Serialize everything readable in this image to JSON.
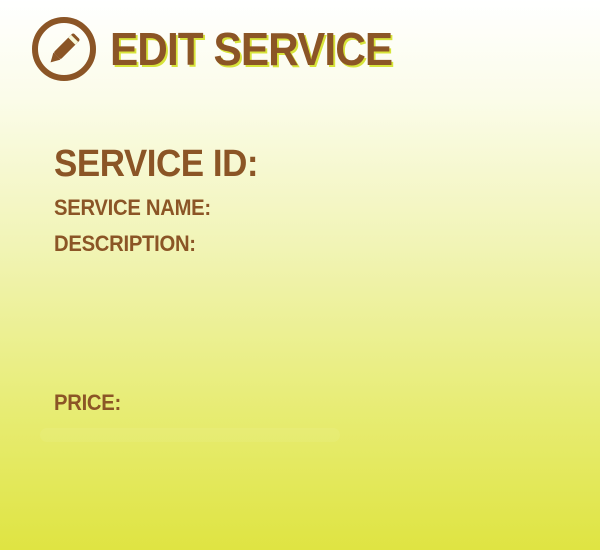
{
  "header": {
    "title": "EDIT SERVICE",
    "icon": "pencil-circle-icon"
  },
  "form": {
    "service_id_label": "SERVICE ID:",
    "service_name_label": "SERVICE NAME:",
    "description_label": "DESCRIPTION:",
    "price_label": "PRICE:"
  },
  "colors": {
    "text": "#8b5526",
    "title_shadow": "#d7e43a",
    "background_top": "#ffffff",
    "background_bottom": "#dfe442"
  }
}
